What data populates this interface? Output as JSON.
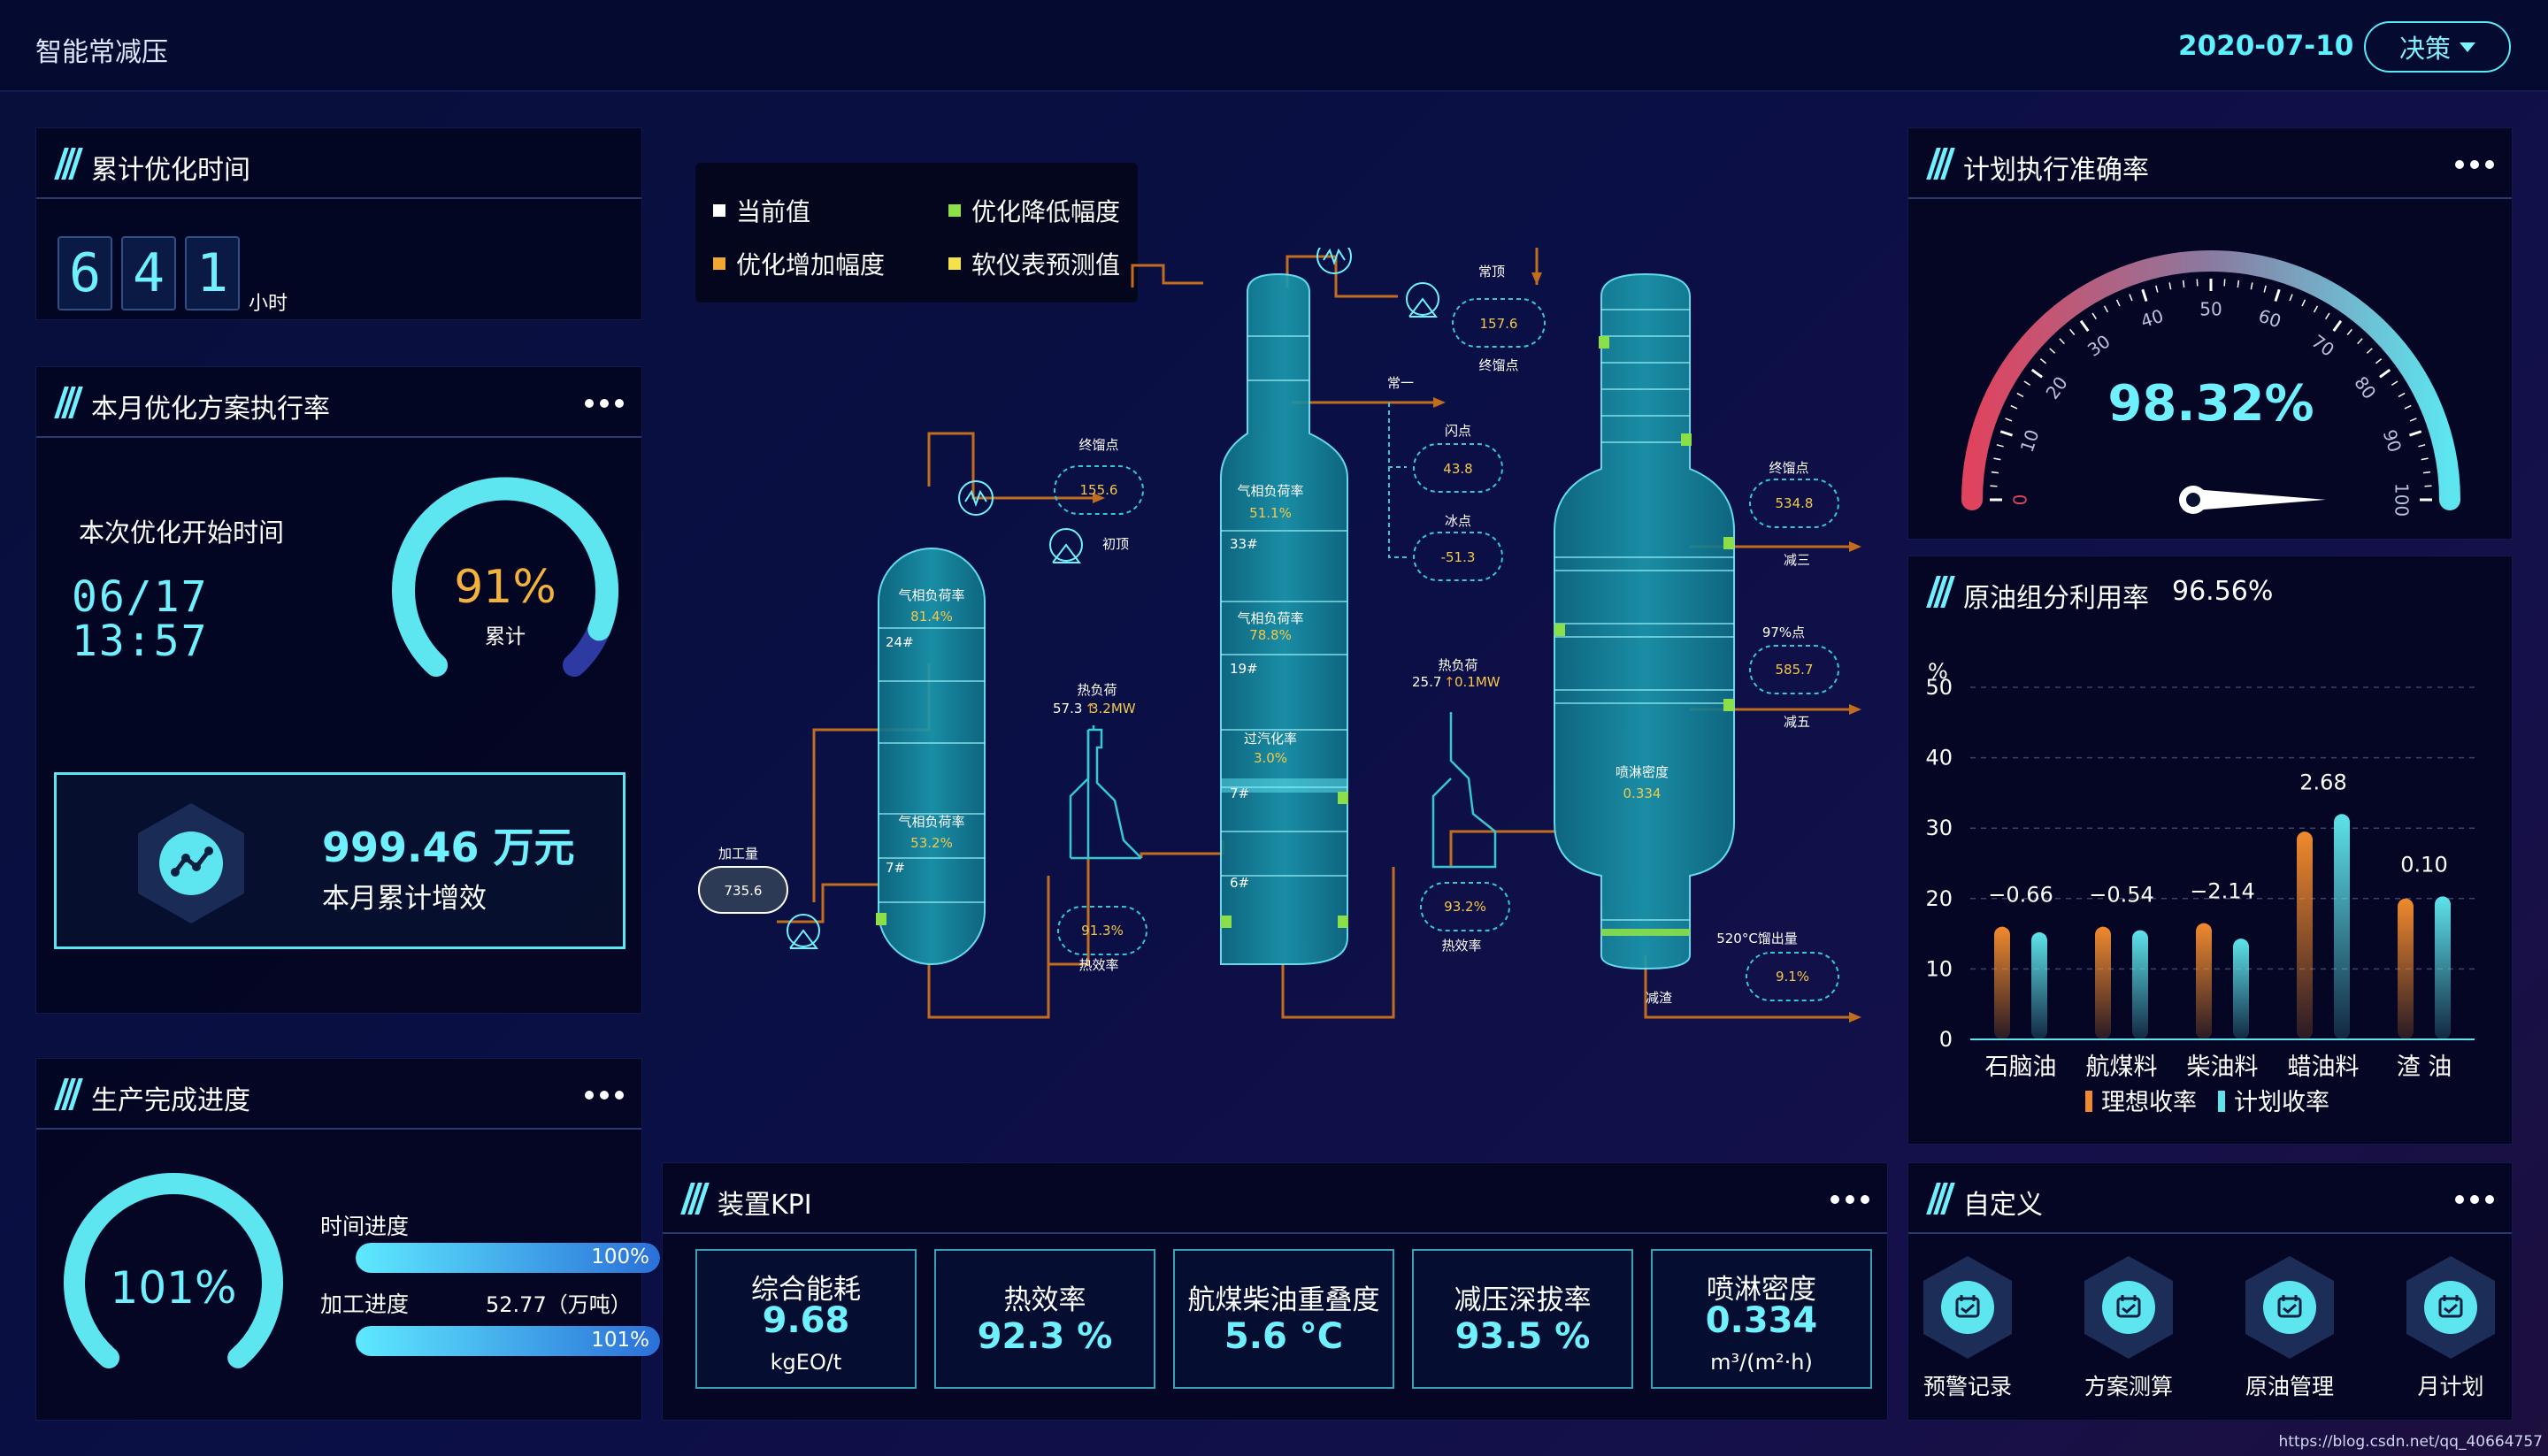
{
  "header": {
    "title": "智能常减压",
    "date": "2020-07-10",
    "decision_label": "决策"
  },
  "cumulative_time": {
    "title": "累计优化时间",
    "digits": [
      "6",
      "4",
      "1"
    ],
    "unit": "小时"
  },
  "monthly_plan": {
    "title": "本月优化方案执行率",
    "start_label": "本次优化开始时间",
    "start_date": "06/17",
    "start_time": "13:57",
    "gauge_value": "91%",
    "gauge_fraction": 0.91,
    "gauge_label": "累计",
    "increase_value": "999.46 万元",
    "increase_label": "本月累计增效"
  },
  "production": {
    "title": "生产完成进度",
    "gauge_value": "101%",
    "gauge_fraction": 1.0,
    "time_label": "时间进度",
    "time_value": "100%",
    "time_fraction": 1.0,
    "process_label": "加工进度",
    "process_amount": "52.77（万吨）",
    "process_value": "101%",
    "process_fraction": 1.0
  },
  "diagram": {
    "legend": [
      {
        "label": "当前值",
        "color": "#ffffff"
      },
      {
        "label": "优化降低幅度",
        "color": "#8be04a"
      },
      {
        "label": "优化增加幅度",
        "color": "#f0a830"
      },
      {
        "label": "软仪表预测值",
        "color": "#f3e24a"
      }
    ],
    "feed_label": "加工量",
    "feed_value": "735.6",
    "t1_endpoint_label": "终馏点",
    "t1_endpoint_value": "155.6",
    "t1_top_label": "初顶",
    "t1_load_top_label": "气相负荷率",
    "t1_load_top_value": "81.4%",
    "t1_tray_24": "24#",
    "t1_load_bot_label": "气相负荷率",
    "t1_load_bot_value": "53.2%",
    "t1_tray_7": "7#",
    "f1_heat_label": "热负荷",
    "f1_heat_current": "57.3",
    "f1_heat_change": "3.2MW",
    "f1_eff_value": "91.3%",
    "f1_eff_label": "热效率",
    "t2_load1_label": "气相负荷率",
    "t2_load1_value": "51.1%",
    "t2_tray_33": "33#",
    "t2_load2_label": "气相负荷率",
    "t2_load2_value": "78.8%",
    "t2_tray_19": "19#",
    "t2_over_label": "过汽化率",
    "t2_over_value": "3.0%",
    "t2_tray_7": "7#",
    "t2_tray_6": "6#",
    "t2_top_label": "常顶",
    "t2_top_value": "157.6",
    "t2_top_endpoint_label": "终馏点",
    "t2_side_label": "常一",
    "flash_label": "闪点",
    "flash_value": "43.8",
    "freeze_label": "冰点",
    "freeze_value": "-51.3",
    "f2_heat_label": "热负荷",
    "f2_heat_current": "25.7",
    "f2_heat_change": "0.1MW",
    "f2_eff_value": "93.2%",
    "f2_eff_label": "热效率",
    "t3_spray_label": "喷淋密度",
    "t3_spray_value": "0.334",
    "t3_end_label": "终馏点",
    "t3_end_value": "534.8",
    "t3_out3": "减三",
    "t3_97_label": "97%点",
    "t3_97_value": "585.7",
    "t3_out5": "减五",
    "t3_520_label": "520°C馏出量",
    "t3_520_value": "9.1%",
    "t3_residue": "减渣"
  },
  "kpi": {
    "title": "装置KPI",
    "cards": [
      {
        "name": "综合能耗",
        "value": "9.68",
        "unit": "kgEO/t"
      },
      {
        "name": "热效率",
        "value": "92.3 %",
        "unit": ""
      },
      {
        "name": "航煤柴油重叠度",
        "value": "5.6 °C",
        "unit": ""
      },
      {
        "name": "减压深拔率",
        "value": "93.5 %",
        "unit": ""
      },
      {
        "name": "喷淋密度",
        "value": "0.334",
        "unit": "m³/(m²·h)"
      }
    ]
  },
  "plan_accuracy": {
    "title": "计划执行准确率",
    "value": "98.32%",
    "fraction": 0.9832,
    "ticks": [
      "0",
      "10",
      "20",
      "30",
      "40",
      "50",
      "60",
      "70",
      "80",
      "90",
      "100"
    ]
  },
  "crude_chart": {
    "title": "原油组分利用率",
    "title_value": "96.56%"
  },
  "chart_data": {
    "type": "bar",
    "categories": [
      "石脑油",
      "航煤料",
      "柴油料",
      "蜡油料",
      "渣 油"
    ],
    "series": [
      {
        "name": "理想收率",
        "values": [
          16,
          16,
          16.5,
          29.5,
          20
        ],
        "color": "#f08a2e"
      },
      {
        "name": "计划收率",
        "values": [
          15.2,
          15.5,
          14.3,
          32,
          20.3
        ],
        "color": "#5ee3ea"
      }
    ],
    "data_labels": [
      "−0.66",
      "−0.54",
      "−2.14",
      "2.68",
      "0.10"
    ],
    "ylabel": "%",
    "ylim": [
      0,
      50
    ],
    "yticks": [
      "0",
      "10",
      "20",
      "30",
      "40",
      "50"
    ],
    "legend_position": "bottom",
    "grid": true
  },
  "custom": {
    "title": "自定义",
    "items": [
      {
        "label": "预警记录"
      },
      {
        "label": "方案测算"
      },
      {
        "label": "原油管理"
      },
      {
        "label": "月计划"
      }
    ]
  },
  "watermark": "https://blog.csdn.net/qq_40664757"
}
